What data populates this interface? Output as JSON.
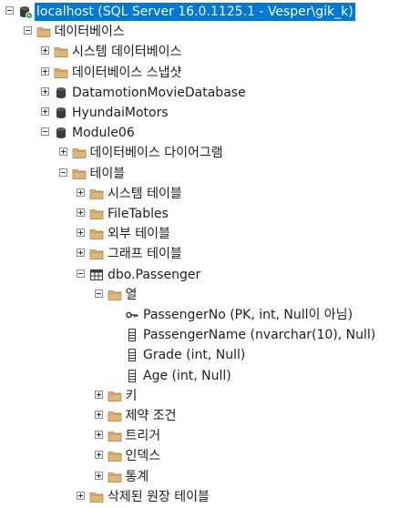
{
  "tree": [
    {
      "name": "server-node",
      "level": 0,
      "expander": "open",
      "icon": "server-icon",
      "label": "localhost (SQL Server 16.0.1125.1 - Vesper\\gik_k)",
      "selected": true
    },
    {
      "name": "databases-folder",
      "level": 1,
      "expander": "open",
      "icon": "folder-icon",
      "label": "데이터베이스"
    },
    {
      "name": "system-databases-folder",
      "level": 2,
      "expander": "closed",
      "icon": "folder-icon",
      "label": "시스템 데이터베이스"
    },
    {
      "name": "database-snapshots-folder",
      "level": 2,
      "expander": "closed",
      "icon": "folder-icon",
      "label": "데이터베이스 스냅샷"
    },
    {
      "name": "db-datamotionmoviedatabase",
      "level": 2,
      "expander": "closed",
      "icon": "database-icon",
      "label": "DatamotionMovieDatabase"
    },
    {
      "name": "db-hyundaimotors",
      "level": 2,
      "expander": "closed",
      "icon": "database-icon",
      "label": "HyundaiMotors"
    },
    {
      "name": "db-module06",
      "level": 2,
      "expander": "open",
      "icon": "database-icon",
      "label": "Module06"
    },
    {
      "name": "database-diagrams-folder",
      "level": 3,
      "expander": "closed",
      "icon": "folder-icon",
      "label": "데이터베이스 다이어그램"
    },
    {
      "name": "tables-folder",
      "level": 3,
      "expander": "open",
      "icon": "folder-icon",
      "label": "테이블"
    },
    {
      "name": "system-tables-folder",
      "level": 4,
      "expander": "closed",
      "icon": "folder-icon",
      "label": "시스템 테이블"
    },
    {
      "name": "filetables-folder",
      "level": 4,
      "expander": "closed",
      "icon": "folder-icon",
      "label": "FileTables"
    },
    {
      "name": "external-tables-folder",
      "level": 4,
      "expander": "closed",
      "icon": "folder-icon",
      "label": "외부 테이블"
    },
    {
      "name": "graph-tables-folder",
      "level": 4,
      "expander": "closed",
      "icon": "folder-icon",
      "label": "그래프 테이블"
    },
    {
      "name": "table-dbo-passenger",
      "level": 4,
      "expander": "open",
      "icon": "table-icon",
      "label": "dbo.Passenger"
    },
    {
      "name": "columns-folder",
      "level": 5,
      "expander": "open",
      "icon": "folder-icon",
      "label": "열"
    },
    {
      "name": "column-passengerno",
      "level": 6,
      "expander": "none",
      "icon": "key-icon",
      "label": "PassengerNo (PK, int, Null이 아님)"
    },
    {
      "name": "column-passengername",
      "level": 6,
      "expander": "none",
      "icon": "column-icon",
      "label": "PassengerName (nvarchar(10), Null)"
    },
    {
      "name": "column-grade",
      "level": 6,
      "expander": "none",
      "icon": "column-icon",
      "label": "Grade (int, Null)"
    },
    {
      "name": "column-age",
      "level": 6,
      "expander": "none",
      "icon": "column-icon",
      "label": "Age (int, Null)"
    },
    {
      "name": "keys-folder",
      "level": 5,
      "expander": "closed",
      "icon": "folder-icon",
      "label": "키"
    },
    {
      "name": "constraints-folder",
      "level": 5,
      "expander": "closed",
      "icon": "folder-icon",
      "label": "제약 조건"
    },
    {
      "name": "triggers-folder",
      "level": 5,
      "expander": "closed",
      "icon": "folder-icon",
      "label": "트리거"
    },
    {
      "name": "indexes-folder",
      "level": 5,
      "expander": "closed",
      "icon": "folder-icon",
      "label": "인덱스"
    },
    {
      "name": "statistics-folder",
      "level": 5,
      "expander": "closed",
      "icon": "folder-icon",
      "label": "통계"
    },
    {
      "name": "dropped-ledger-tables-folder",
      "level": 4,
      "expander": "closed",
      "icon": "folder-icon",
      "label": "삭제된 원장 테이블"
    }
  ],
  "colors": {
    "selection": "#0078d7",
    "folder": "#dcb67a",
    "folder_dark": "#c09553",
    "database": "#3c3c3c",
    "server_badge": "#2aa84a"
  }
}
